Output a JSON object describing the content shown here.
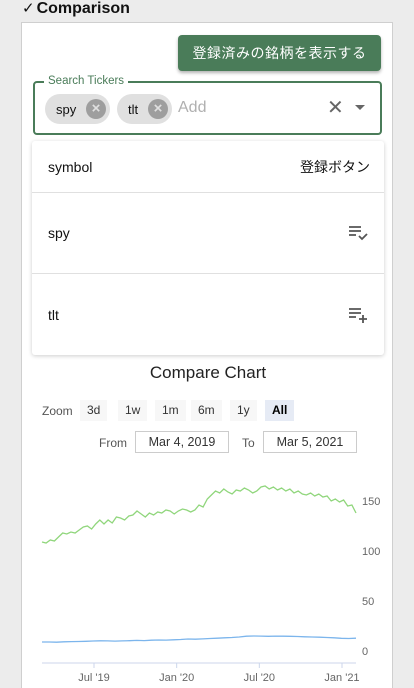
{
  "section": {
    "title": "Comparison",
    "check": "✓"
  },
  "show_registered_button": "登録済みの銘柄を表示する",
  "search": {
    "legend": "Search Tickers",
    "chips": [
      "spy",
      "tlt"
    ],
    "placeholder": "Add",
    "clear_icon": "close-icon",
    "dropdown_icon": "arrow-drop-down-icon"
  },
  "list": {
    "header": {
      "col1": "symbol",
      "col2": "登録ボタン"
    },
    "rows": [
      {
        "symbol": "spy",
        "icon": "playlist-check-icon"
      },
      {
        "symbol": "tlt",
        "icon": "playlist-add-icon"
      }
    ]
  },
  "chart": {
    "title": "Compare Chart",
    "zoom_label": "Zoom",
    "zoom_buttons": [
      "3d",
      "1w",
      "1m",
      "6m",
      "1y",
      "All"
    ],
    "active_zoom": "All",
    "from_label": "From",
    "from_value": "Mar 4, 2019",
    "to_label": "To",
    "to_value": "Mar 5, 2021"
  },
  "chart_data": {
    "type": "line",
    "y_ticks": [
      0,
      50,
      100,
      150
    ],
    "ylim": [
      0,
      170
    ],
    "x_ticks": [
      "Jul '19",
      "Jan '20",
      "Jul '20",
      "Jan '21"
    ],
    "series": [
      {
        "color": "#90d67c",
        "values": [
          109,
          108,
          111,
          110,
          114,
          118,
          117,
          119,
          118,
          121,
          124,
          125,
          122,
          127,
          131,
          127,
          131,
          128,
          134,
          133,
          131,
          135,
          136,
          140,
          137,
          134,
          138,
          136,
          139,
          138,
          141,
          140,
          137,
          140,
          142,
          141,
          139,
          141,
          146,
          144,
          152,
          156,
          160,
          158,
          162,
          159,
          157,
          161,
          160,
          163,
          161,
          158,
          160,
          164,
          165,
          162,
          164,
          161,
          163,
          160,
          162,
          158,
          160,
          157,
          156,
          158,
          155,
          157,
          154,
          155,
          150,
          152,
          149,
          151,
          145,
          146,
          138
        ]
      },
      {
        "color": "#7cb5ec",
        "values": [
          9,
          9,
          8.8,
          9.2,
          9.4,
          9.5,
          9.7,
          10,
          10.2,
          10.1,
          9.9,
          10.1,
          10.3,
          10.6,
          10.4,
          10.8,
          11,
          10.9,
          11.2,
          11.5,
          12,
          11.8,
          12.1,
          12.5,
          12.8,
          13.2,
          13.5,
          14,
          14.8,
          15,
          14.9,
          14.7,
          14.9,
          14.8,
          14.7,
          14.5,
          14.2,
          14,
          13.8,
          13.5,
          13.2,
          12.7,
          12.5,
          12.8
        ]
      }
    ]
  }
}
